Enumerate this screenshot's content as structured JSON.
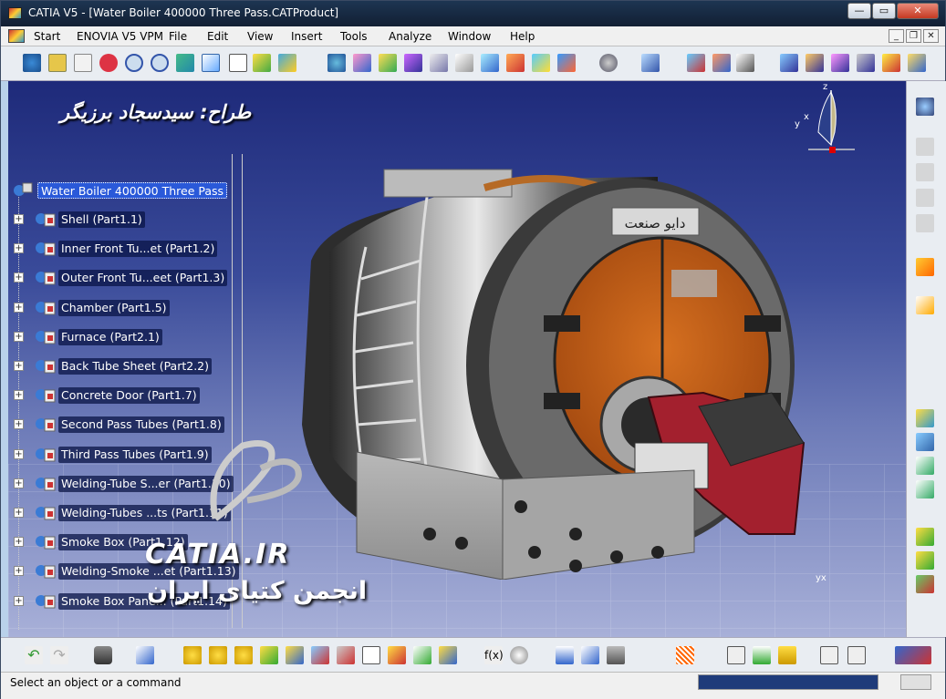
{
  "window": {
    "title": "CATIA V5 - [Water Boiler 400000 Three Pass.CATProduct]",
    "buttons": {
      "minimize": "—",
      "restore": "▭",
      "close": "✕"
    }
  },
  "menu": {
    "items": [
      "Start",
      "ENOVIA V5 VPM",
      "File",
      "Edit",
      "View",
      "Insert",
      "Tools",
      "Analyze",
      "Window",
      "Help"
    ]
  },
  "mdi": {
    "minimize": "_",
    "restore": "❐",
    "close": "✕"
  },
  "overlay": {
    "designer_text": "طراح: سیدسجاد برزیگر",
    "catia_ir": "CATIA.IR",
    "forum_text": "انجمن کتیای ایران",
    "brand_plate": "دایو صنعت"
  },
  "tree": {
    "root": "Water Boiler 400000 Three Pass",
    "items": [
      "Shell (Part1.1)",
      "Inner Front Tu...et  (Part1.2)",
      "Outer Front Tu...eet (Part1.3)",
      "Chamber (Part1.5)",
      "Furnace (Part2.1)",
      "Back Tube Sheet (Part2.2)",
      "Concrete Door (Part1.7)",
      "Second Pass Tubes (Part1.8)",
      "Third Pass Tubes (Part1.9)",
      "Welding-Tube S...er (Part1.10)",
      "Welding-Tubes ...ts (Part1.11)",
      "Smoke Box (Part1.12)",
      "Welding-Smoke ...et (Part1.13)",
      "Smoke Box Pane... (Part1.14)"
    ]
  },
  "axis": {
    "z": "z",
    "y": "y",
    "x": "x"
  },
  "compass_label": "yx",
  "status": {
    "text": "Select an object or a command"
  },
  "colors": {
    "titlebar": "#1d3552",
    "viewport_top": "#1e2a7a",
    "viewport_bottom": "#a8b0d8",
    "tree_selected": "#2a59d9",
    "door_orange": "#c8621a",
    "burner_red": "#a3202e"
  }
}
